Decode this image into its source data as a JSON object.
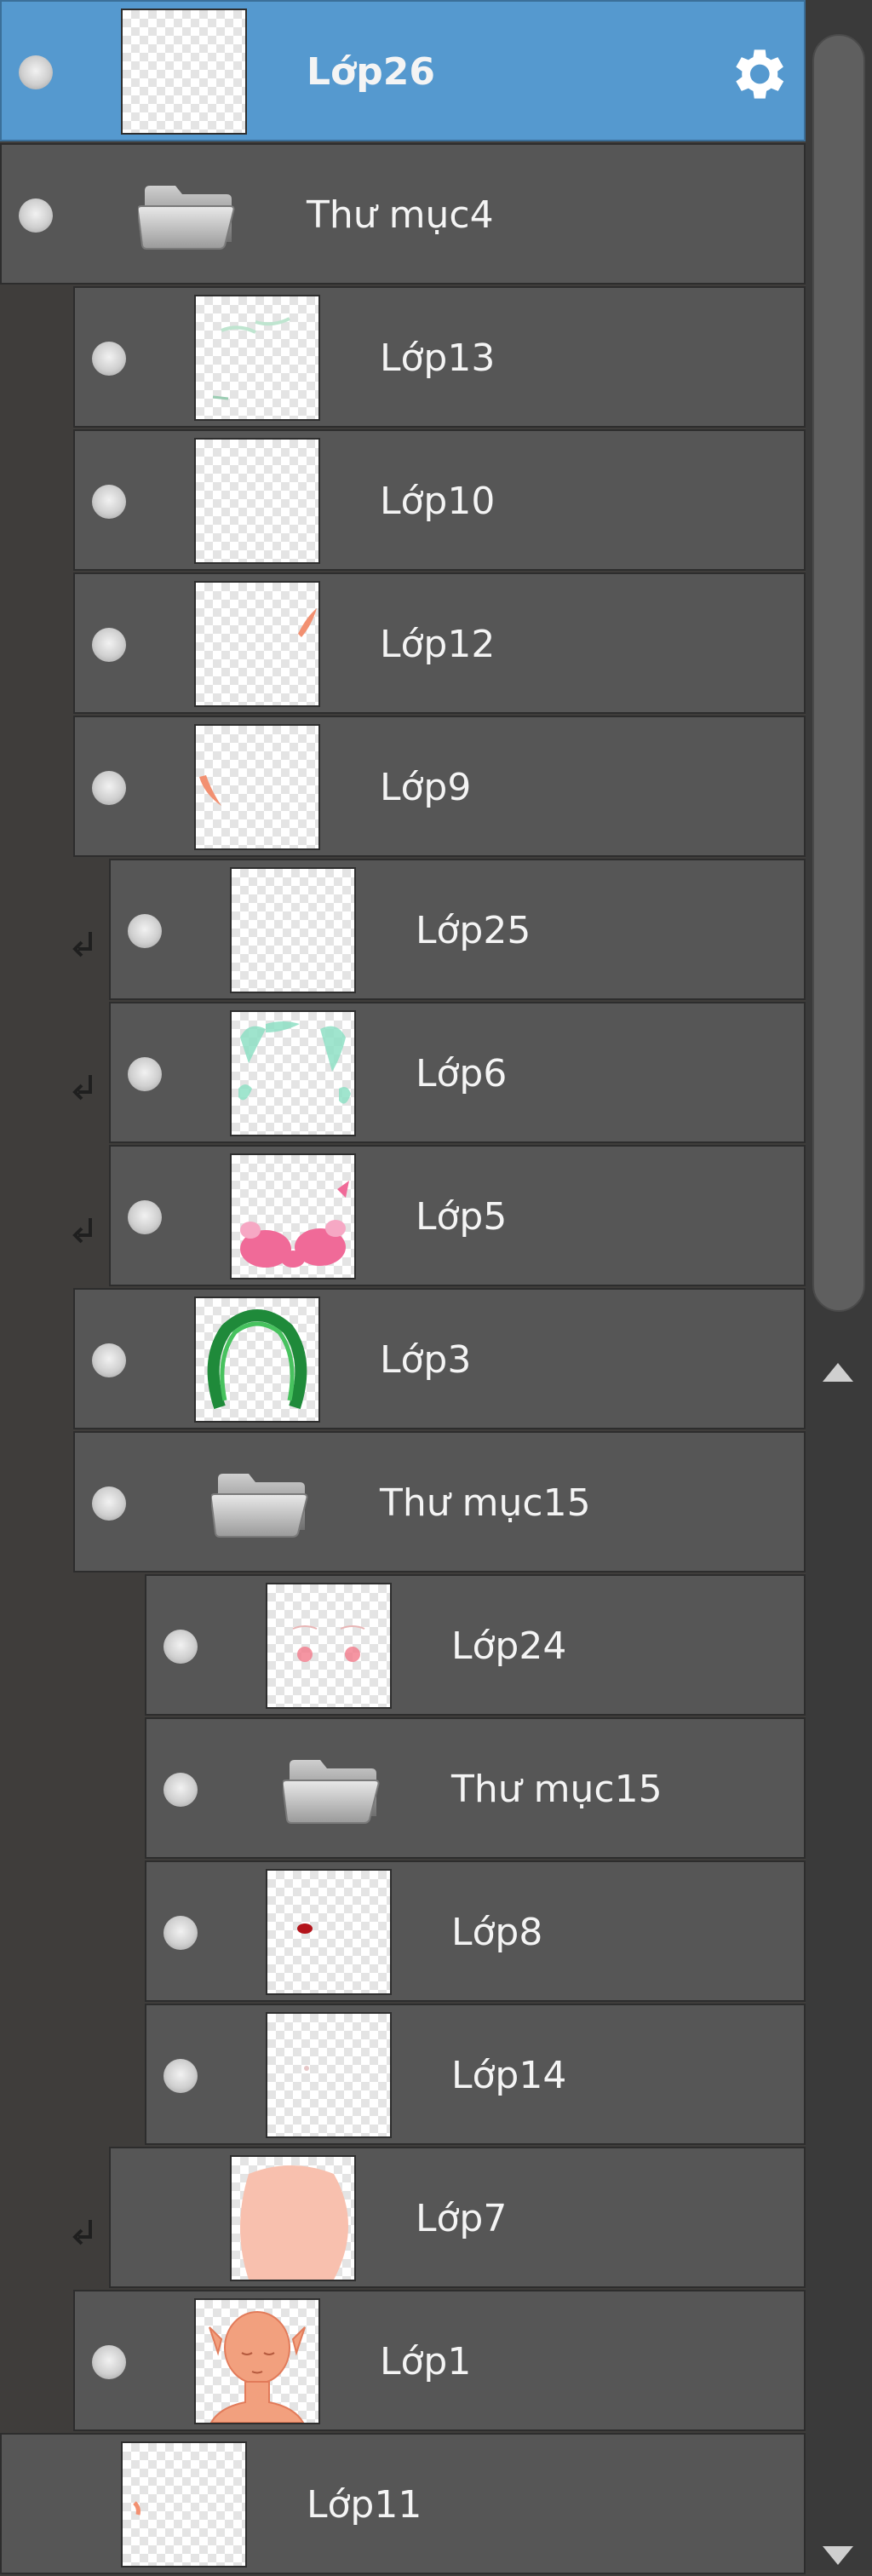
{
  "layers": [
    {
      "label": "Lớp26",
      "type": "layer",
      "visible": true,
      "selected": true,
      "clipped": false,
      "indent": 0,
      "thumb": "blank"
    },
    {
      "label": "Thư mục4",
      "type": "folder",
      "visible": true,
      "selected": false,
      "clipped": false,
      "indent": 0
    },
    {
      "label": "Lớp13",
      "type": "layer",
      "visible": true,
      "selected": false,
      "clipped": false,
      "indent": 1,
      "thumb": "faint-green"
    },
    {
      "label": "Lớp10",
      "type": "layer",
      "visible": true,
      "selected": false,
      "clipped": false,
      "indent": 1,
      "thumb": "blank"
    },
    {
      "label": "Lớp12",
      "type": "layer",
      "visible": true,
      "selected": false,
      "clipped": false,
      "indent": 1,
      "thumb": "orange-stroke-right"
    },
    {
      "label": "Lớp9",
      "type": "layer",
      "visible": true,
      "selected": false,
      "clipped": false,
      "indent": 1,
      "thumb": "orange-stroke-left"
    },
    {
      "label": "Lớp25",
      "type": "layer",
      "visible": true,
      "selected": false,
      "clipped": true,
      "indent": 1,
      "thumb": "blank"
    },
    {
      "label": "Lớp6",
      "type": "layer",
      "visible": true,
      "selected": false,
      "clipped": true,
      "indent": 1,
      "thumb": "teal-hair"
    },
    {
      "label": "Lớp5",
      "type": "layer",
      "visible": true,
      "selected": false,
      "clipped": true,
      "indent": 1,
      "thumb": "pink-hair"
    },
    {
      "label": "Lớp3",
      "type": "layer",
      "visible": true,
      "selected": false,
      "clipped": false,
      "indent": 1,
      "thumb": "green-hair"
    },
    {
      "label": "Thư mục15",
      "type": "folder",
      "visible": true,
      "selected": false,
      "clipped": false,
      "indent": 1
    },
    {
      "label": "Lớp24",
      "type": "layer",
      "visible": true,
      "selected": false,
      "clipped": false,
      "indent": 2,
      "thumb": "blush"
    },
    {
      "label": "Thư mục15",
      "type": "folder",
      "visible": true,
      "selected": false,
      "clipped": false,
      "indent": 2
    },
    {
      "label": "Lớp8",
      "type": "layer",
      "visible": true,
      "selected": false,
      "clipped": false,
      "indent": 2,
      "thumb": "red-dot"
    },
    {
      "label": "Lớp14",
      "type": "layer",
      "visible": true,
      "selected": false,
      "clipped": false,
      "indent": 2,
      "thumb": "faint-dot"
    },
    {
      "label": "Lớp7",
      "type": "layer",
      "visible": false,
      "selected": false,
      "clipped": true,
      "indent": 1,
      "thumb": "skin-face"
    },
    {
      "label": "Lớp1",
      "type": "layer",
      "visible": true,
      "selected": false,
      "clipped": false,
      "indent": 1,
      "thumb": "face-sketch"
    },
    {
      "label": "Lớp11",
      "type": "layer",
      "visible": false,
      "selected": false,
      "clipped": false,
      "indent": 0,
      "thumb": "small-mark"
    }
  ],
  "colors": {
    "selected": "#5599cf",
    "row": "#565656",
    "panel": "#3f3d3b"
  },
  "icons": {
    "visibility": "eye-dot-icon",
    "folder": "folder-icon",
    "settings": "gear-icon",
    "clip": "clip-arrow-icon"
  }
}
